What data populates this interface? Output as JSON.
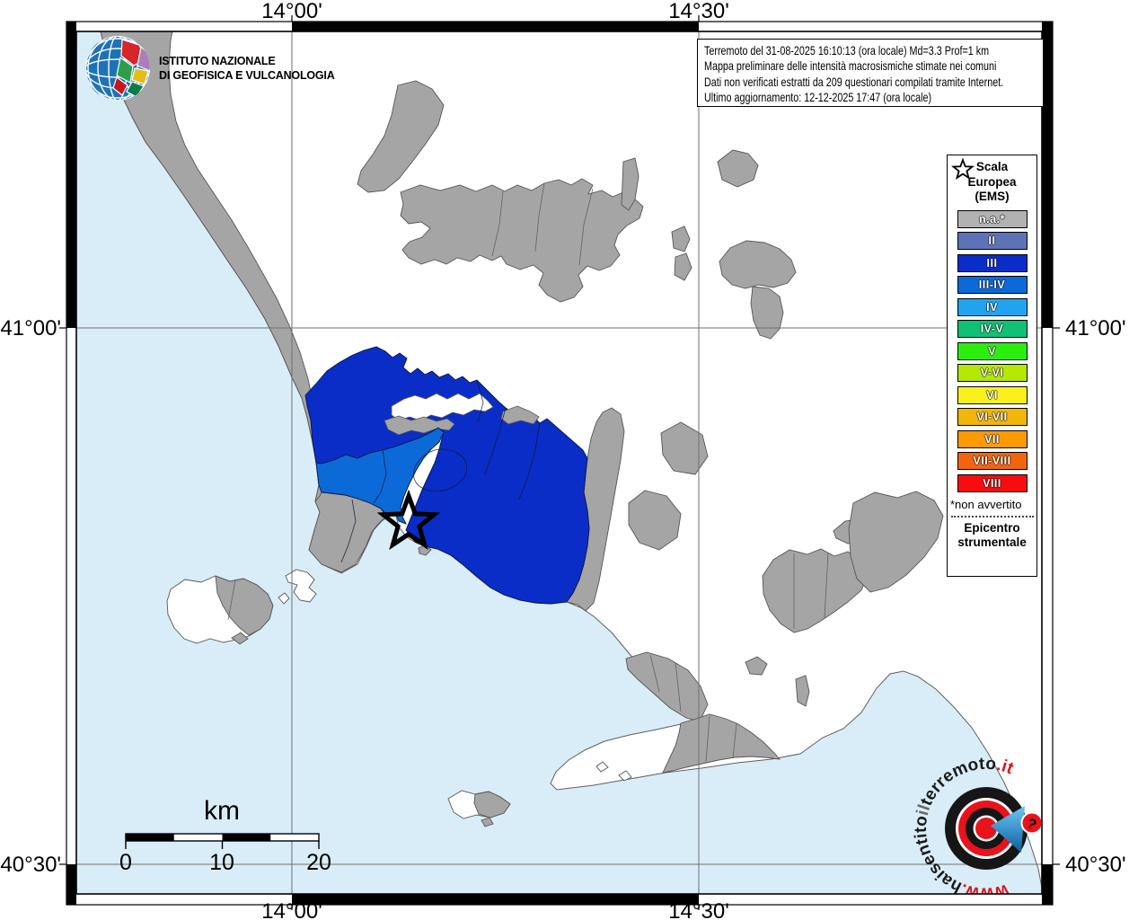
{
  "info_box": {
    "line1": "Terremoto del 31-08-2025 16:10:13 (ora locale) Md=3.3 Prof=1 km",
    "line2": "Mappa preliminare delle intensità macrosismiche stimate nei comuni",
    "line3": "Dati non verificati estratti da 209 questionari compilati tramite Internet.",
    "line4": "Ultimo aggiornamento: 12-12-2025 17:47 (ora locale)"
  },
  "logo": {
    "line1": "ISTITUTO NAZIONALE",
    "line2": "DI GEOFISICA E VULCANOLOGIA"
  },
  "legend": {
    "title": [
      "Scala",
      "Europea",
      "(EMS)"
    ],
    "items": [
      {
        "label": "n.a.*",
        "color": "#b2b2b2"
      },
      {
        "label": "II",
        "color": "#5e72b8"
      },
      {
        "label": "III",
        "color": "#0a2dc8"
      },
      {
        "label": "III-IV",
        "color": "#0b6ad8"
      },
      {
        "label": "IV",
        "color": "#20a4f0"
      },
      {
        "label": "IV-V",
        "color": "#0fc173"
      },
      {
        "label": "V",
        "color": "#2bee0e"
      },
      {
        "label": "V-VI",
        "color": "#b3e704"
      },
      {
        "label": "VI",
        "color": "#f9f01c"
      },
      {
        "label": "VI-VII",
        "color": "#f3b607"
      },
      {
        "label": "VII",
        "color": "#fc9a02"
      },
      {
        "label": "VII-VIII",
        "color": "#f3650d"
      },
      {
        "label": "VIII",
        "color": "#f70d0f"
      }
    ],
    "footnote": "*non avvertito",
    "epicenter_line1": "Epicentro",
    "epicenter_line2": "strumentale"
  },
  "axes": {
    "lon": [
      "14°00'",
      "14°30'"
    ],
    "lat": [
      "41°00'",
      "40°30'"
    ]
  },
  "scalebar": {
    "unit": "km",
    "ticks": [
      "0",
      "10",
      "20"
    ]
  },
  "watermark": {
    "www": "www.",
    "hai": "haisentito",
    "il": "il",
    "terremoto": "terremoto",
    "it": ".it"
  },
  "map_colors": {
    "sea": "#d9edf8",
    "na": "#a5a5a5",
    "intensity_III": "#0a2dc8",
    "intensity_III_IV": "#0b6ad8"
  }
}
